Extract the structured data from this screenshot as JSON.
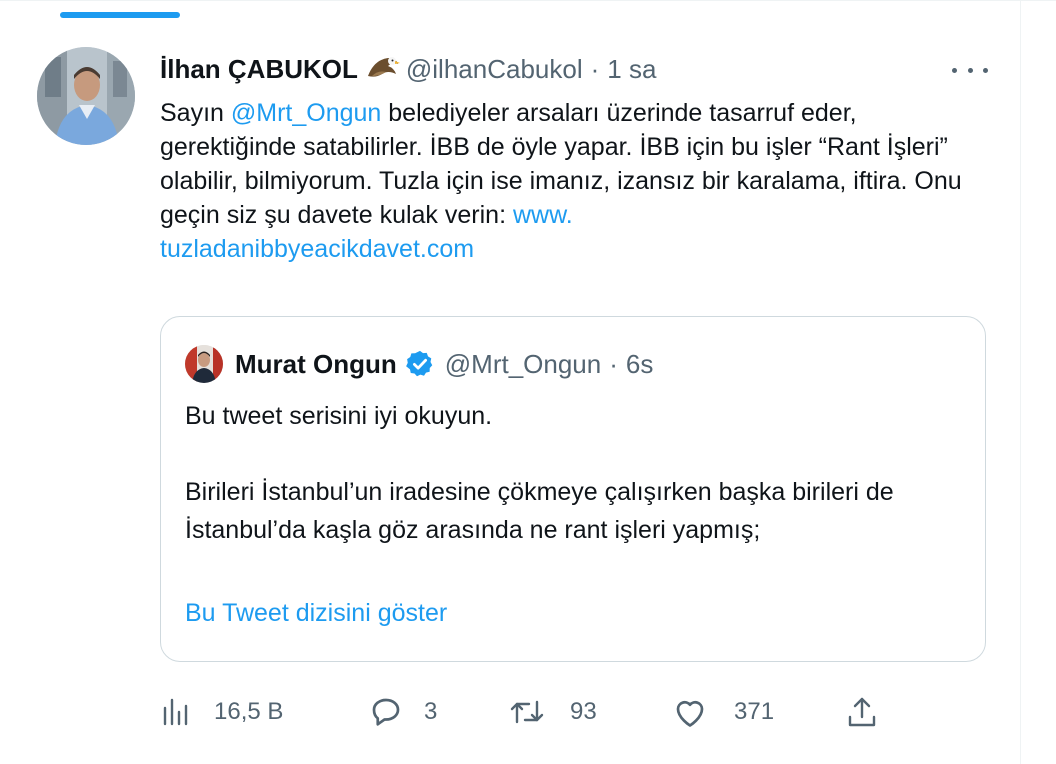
{
  "tweet": {
    "author": {
      "display_name": "İlhan ÇABUKOL",
      "handle": "@ilhanCabukol",
      "badge_icon": "eagle-emoji-icon"
    },
    "separator": "·",
    "time": "1 sa",
    "text": {
      "part1": "Sayın ",
      "mention": "@Mrt_Ongun",
      "part2": " belediyeler arsaları üzerinde tasarruf eder, gerektiğinde satabilirler. İBB de öyle yapar. İBB için bu işler “Rant İşleri” olabilir, bilmiyorum. Tuzla için ise imanız, izansız bir karalama, iftira. Onu geçin siz şu davete kulak verin: ",
      "link": "www.\ntuzladanibbyeacikdavet.com"
    },
    "more_icon": "more-dots-icon"
  },
  "quote": {
    "author": {
      "display_name": "Murat Ongun",
      "handle": "@Mrt_Ongun",
      "verified_icon": "verified-badge-icon"
    },
    "separator": "·",
    "time": "6s",
    "line1": "Bu tweet serisini iyi okuyun.",
    "line2": "Birileri İstanbul’un iradesine çökmeye çalışırken başka birileri de İstanbul’da kaşla göz arasında ne rant işleri yapmış;",
    "show_thread": "Bu Tweet dizisini göster"
  },
  "actions": {
    "views": {
      "icon": "views-chart-icon",
      "count": "16,5 B"
    },
    "replies": {
      "icon": "reply-bubble-icon",
      "count": "3"
    },
    "retweets": {
      "icon": "retweet-icon",
      "count": "93"
    },
    "likes": {
      "icon": "heart-icon",
      "count": "371"
    },
    "share": {
      "icon": "share-upload-icon"
    }
  },
  "colors": {
    "accent": "#1d9bf0",
    "text": "#0f1419",
    "secondary": "#536471",
    "border": "#cfd9de"
  }
}
